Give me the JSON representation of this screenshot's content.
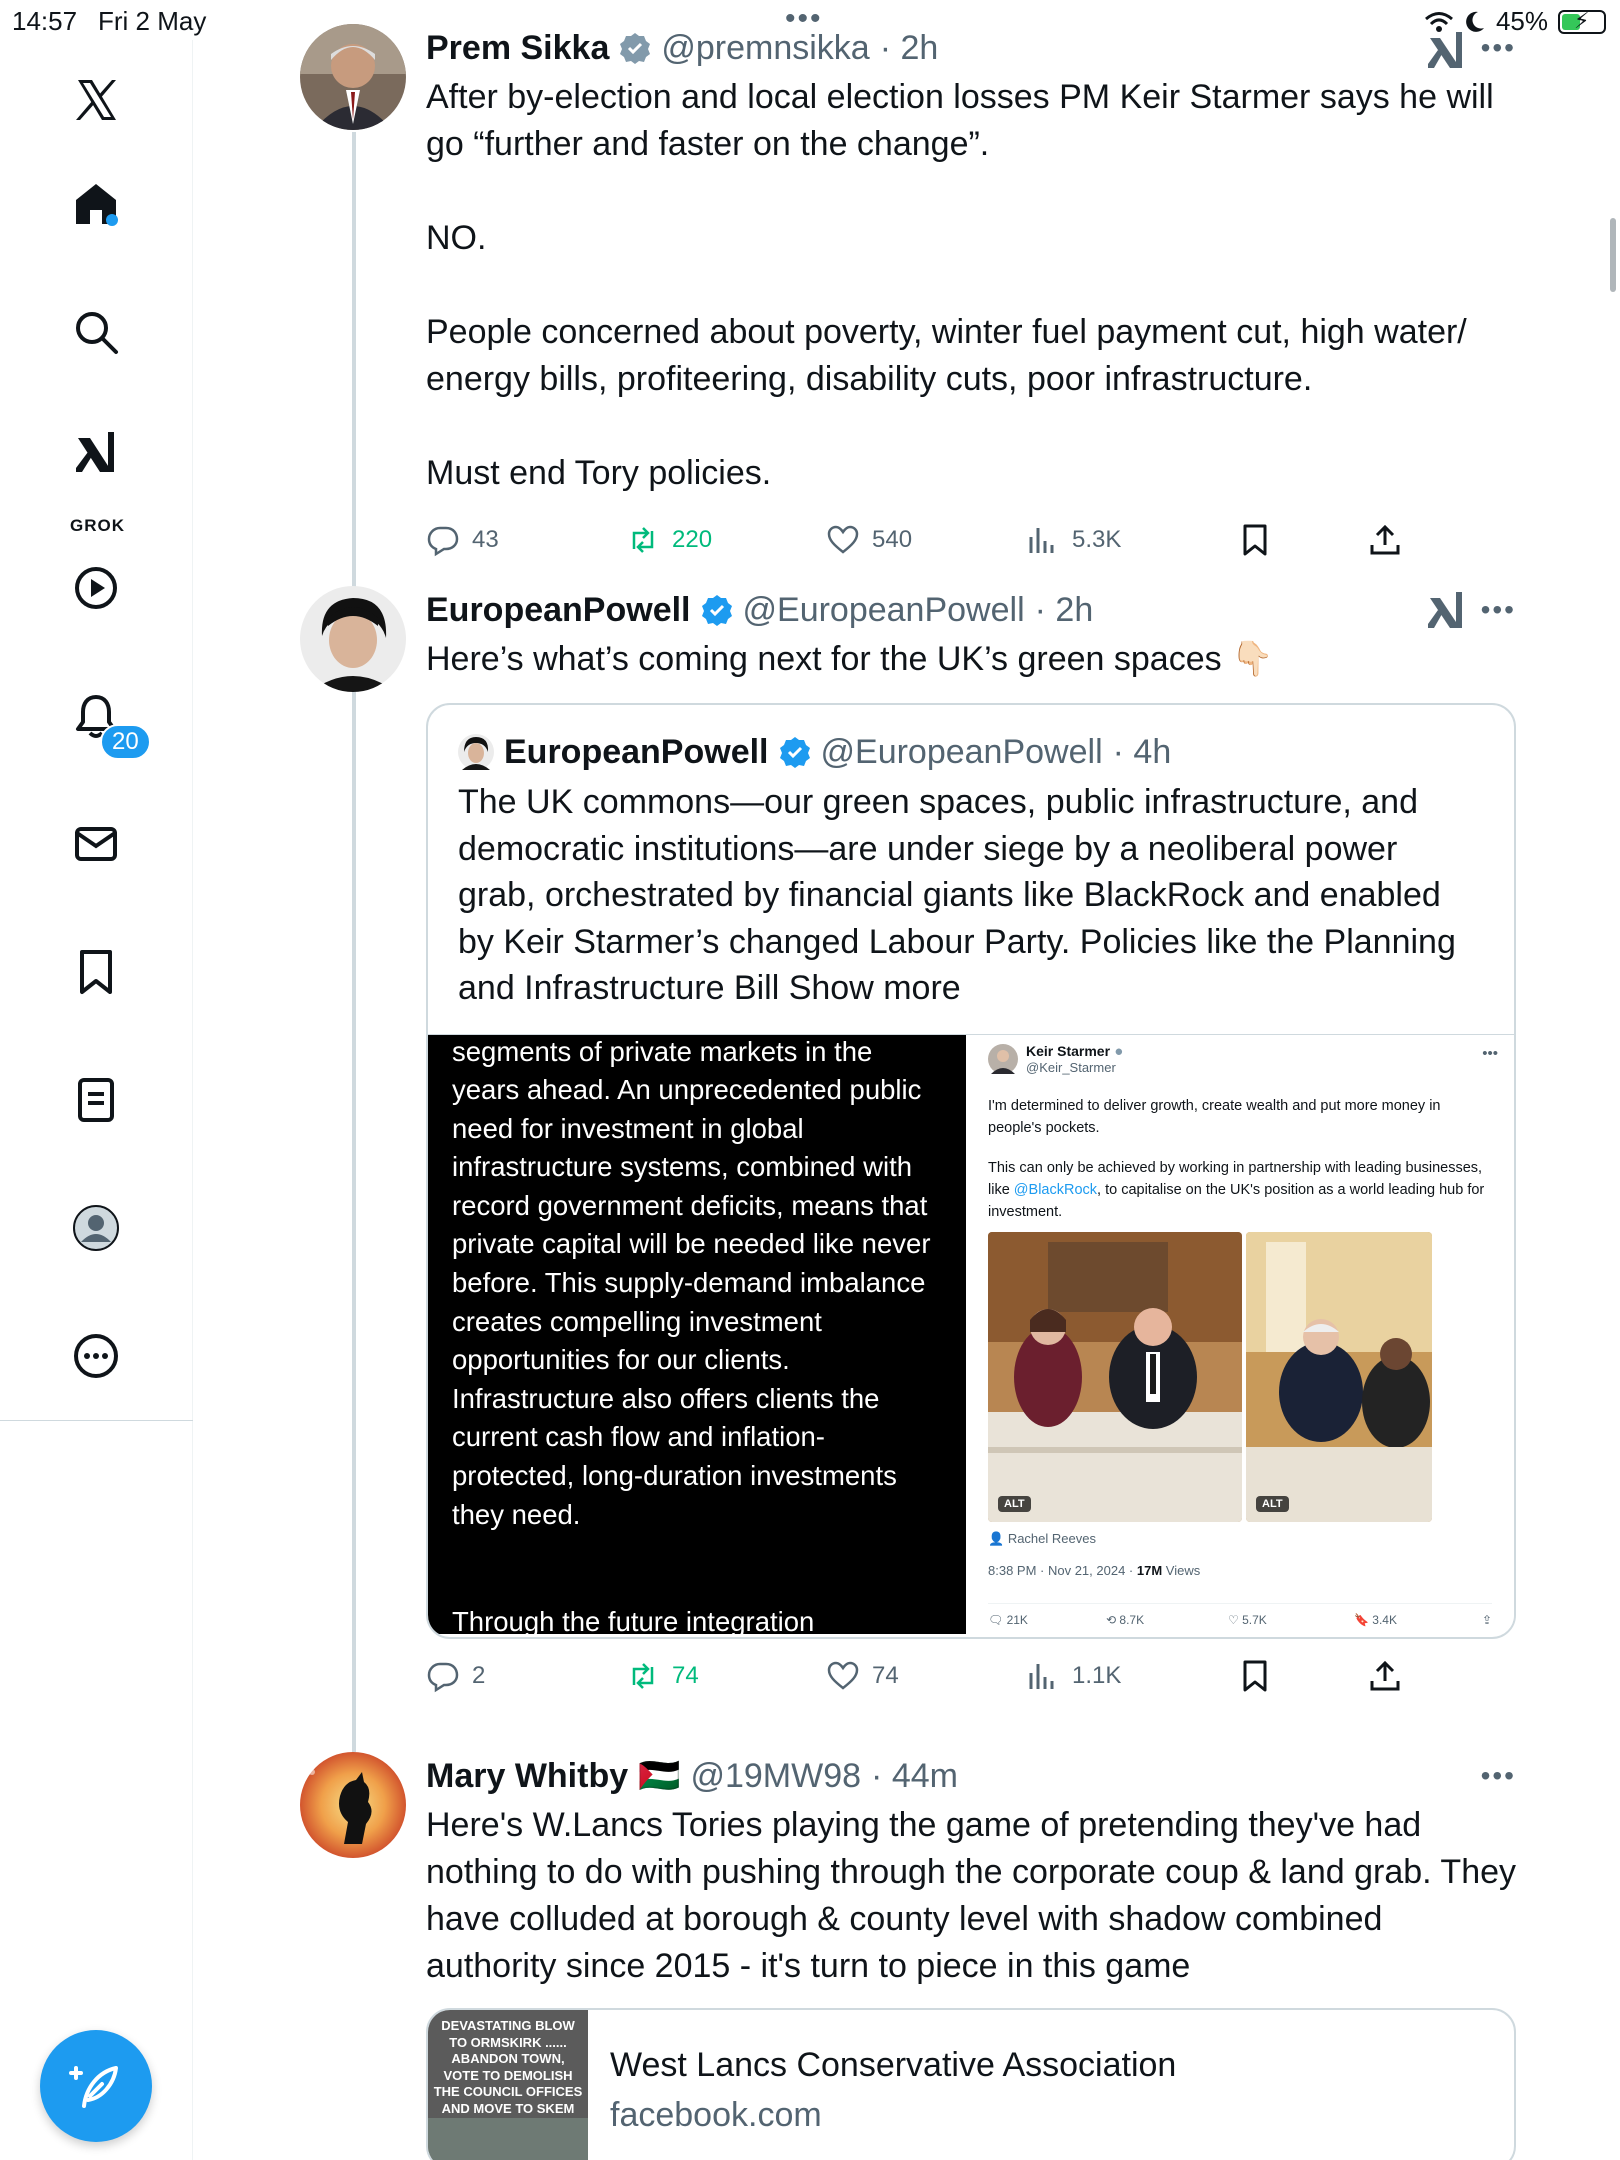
{
  "status_bar": {
    "time": "14:57",
    "date": "Fri 2 May",
    "battery": "45%"
  },
  "sidebar": {
    "grok_label": "GROK",
    "notifications_badge": "20"
  },
  "posts": [
    {
      "name": "Prem Sikka",
      "handle": "@premnsikka",
      "time": "· 2h",
      "text": "After by-election and local election losses PM Keir Starmer says he will go “further and faster on the change”.\n\nNO.\n\nPeople concerned about poverty, winter fuel payment cut, high water/ energy bills, profiteering, disability cuts, poor infrastructure.\n\nMust end Tory policies.",
      "replies": "43",
      "reposts": "220",
      "likes": "540",
      "views": "5.3K"
    },
    {
      "name": "EuropeanPowell",
      "handle": "@EuropeanPowell",
      "time": "· 2h",
      "text": "Here’s what’s coming next for the UK’s green spaces 👇🏻",
      "quote": {
        "name": "EuropeanPowell",
        "handle": "@EuropeanPowell",
        "time": "· 4h",
        "text": "The UK commons—our green spaces, public infrastructure, and democratic institutions—are under siege by a neoliberal power grab, orchestrated by financial giants like BlackRock and enabled by Keir Starmer’s changed Labour Party. Policies like the Planning and Infrastructure Bill",
        "show_more": "Show more",
        "dark_text": "segments of private markets in the years ahead. An unprecedented public need for investment in global infrastructure systems, combined with record government deficits, means that private capital will be needed like never before. This supply-demand imbalance creates compelling investment opportunities for our clients. Infrastructure also offers clients the current cash flow and inflation-protected, long-duration investments they need.",
        "dark_text_tail": "Through the future integration",
        "screenshot": {
          "name": "Keir Starmer",
          "handle": "@Keir_Starmer",
          "text1": "I'm determined to deliver growth, create wealth and put more money in people's pockets.",
          "text2_a": "This can only be achieved by working in partnership with leading businesses, like ",
          "text2_link": "@BlackRock",
          "text2_b": ", to capitalise on the UK's position as a world leading hub for investment.",
          "alt": "ALT",
          "tagged": "Rachel Reeves",
          "meta": "8:38 PM · Nov 21, 2024 · ",
          "views_bold": "17M",
          "views_word": " Views",
          "replies": "21K",
          "reposts": "8.7K",
          "likes": "5.7K",
          "bookmarks": "3.4K"
        }
      },
      "replies": "2",
      "reposts": "74",
      "likes": "74",
      "views": "1.1K"
    },
    {
      "name": "Mary Whitby",
      "flag": "🇵🇸",
      "handle": "@19MW98",
      "time": "· 44m",
      "text": "Here's W.Lancs Tories playing the game of pretending they've had nothing to do with pushing through the corporate coup & land grab. They have colluded at borough & county level with shadow combined authority since 2015 - it's turn to piece in this game",
      "link": {
        "title": "West Lancs Conservative Association",
        "domain": "facebook.com",
        "thumb_text": "DEVASTATING BLOW TO ORMSKIRK ...... ABANDON TOWN, VOTE TO DEMOLISH THE COUNCIL OFFICES AND MOVE TO SKEM"
      }
    }
  ],
  "colors": {
    "accent": "#1d9bf0",
    "repost": "#00ba7c",
    "secondary_text": "#536471"
  }
}
